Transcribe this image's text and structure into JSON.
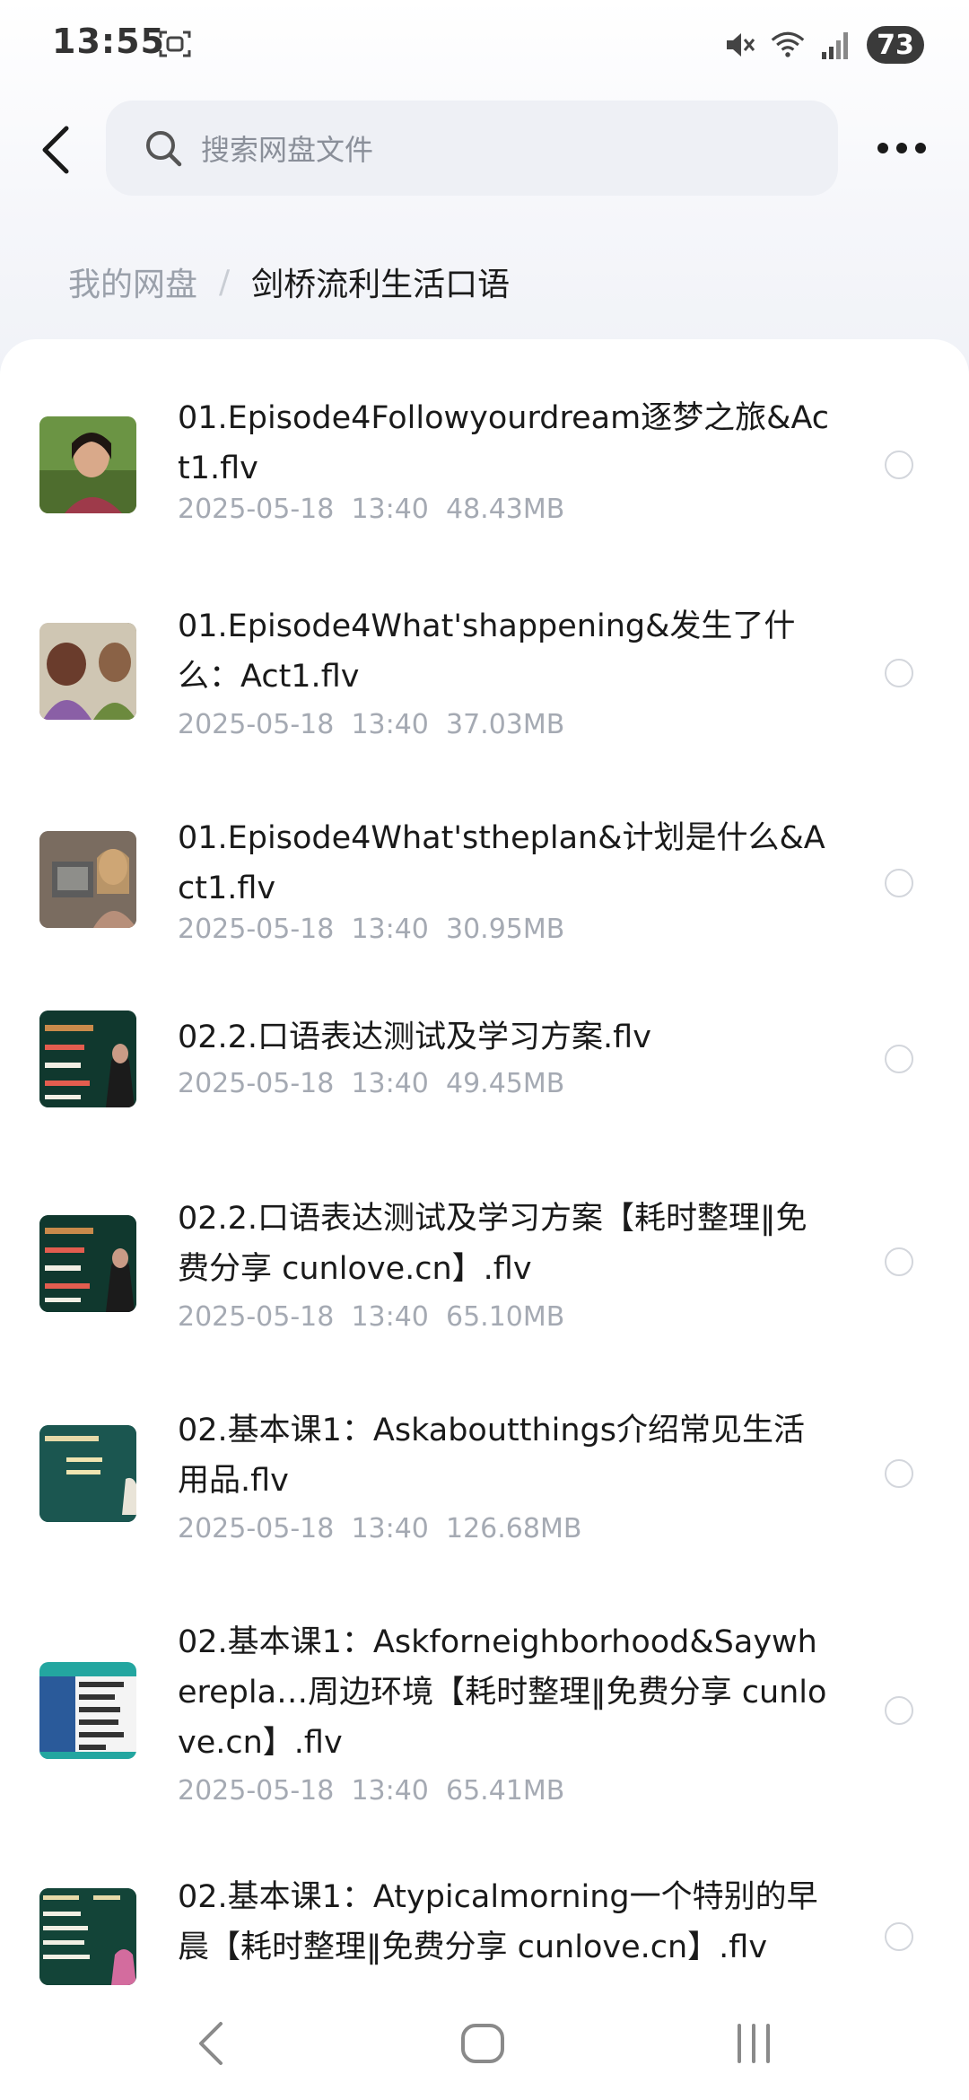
{
  "status_bar": {
    "time": "13:55",
    "battery": "73",
    "icons": [
      "screenshot-icon",
      "mute-icon",
      "wifi-icon",
      "signal-icon"
    ]
  },
  "header": {
    "search_placeholder": "搜索网盘文件",
    "icons": [
      "back-arrow-icon",
      "search-icon",
      "more-icon"
    ]
  },
  "breadcrumb": {
    "root": "我的网盘",
    "separator": "/",
    "current": "剑桥流利生活口语"
  },
  "files": [
    {
      "name": "01.Episode4Followyourdream逐梦之旅&Act1.flv",
      "date": "2025-05-18",
      "time": "13:40",
      "size": "48.43MB",
      "thumb": "video-frame-woman-phone"
    },
    {
      "name": "01.Episode4What'shappening&发生了什么：Act1.flv",
      "date": "2025-05-18",
      "time": "13:40",
      "size": "37.03MB",
      "thumb": "video-frame-people"
    },
    {
      "name": "01.Episode4What'stheplan&计划是什么&Act1.flv",
      "date": "2025-05-18",
      "time": "13:40",
      "size": "30.95MB",
      "thumb": "video-frame-room"
    },
    {
      "name": "02.2.口语表达测试及学习方案.flv",
      "date": "2025-05-18",
      "time": "13:40",
      "size": "49.45MB",
      "thumb": "chalkboard-slide"
    },
    {
      "name": "02.2.口语表达测试及学习方案【耗时整理‖免费分享 cunlove.cn】.flv",
      "date": "2025-05-18",
      "time": "13:40",
      "size": "65.10MB",
      "thumb": "chalkboard-slide"
    },
    {
      "name": "02.基本课1：Askaboutthings介绍常见生活用品.flv",
      "date": "2025-05-18",
      "time": "13:40",
      "size": "126.68MB",
      "thumb": "teal-slide"
    },
    {
      "name": "02.基本课1：Askforneighborhood&Saywherepla…周边环境【耗时整理‖免费分享 cunlove.cn】.flv",
      "date": "2025-05-18",
      "time": "13:40",
      "size": "65.41MB",
      "thumb": "table-slide"
    },
    {
      "name": "02.基本课1：Atypicalmorning一个特别的早晨【耗时整理‖免费分享 cunlove.cn】.flv",
      "date": "",
      "time": "",
      "size": "",
      "thumb": "chalkboard-slide-2"
    }
  ],
  "nav_bar": {
    "icons": [
      "nav-back-icon",
      "nav-home-icon",
      "nav-recents-icon"
    ]
  }
}
